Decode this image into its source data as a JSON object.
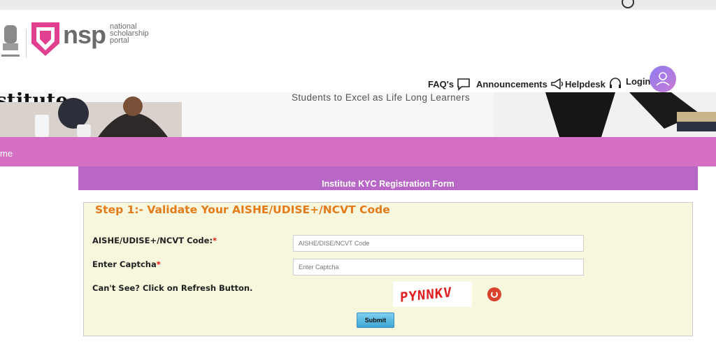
{
  "header": {
    "logo_text": "nsp",
    "logo_sub": [
      "national",
      "scholarship",
      "portal"
    ]
  },
  "nav": {
    "faqs": "FAQ's",
    "announcements": "Announcements",
    "helpdesk": "Helpdesk",
    "login": "Login"
  },
  "banner": {
    "title_fragment": "stitute",
    "tagline": "Students to Excel as Life Long Learners"
  },
  "menu": {
    "home_fragment": "me"
  },
  "form": {
    "title": "Institute KYC Registration Form",
    "step_title": "Step 1:- Validate Your AISHE/UDISE+/NCVT Code",
    "code_label": "AISHE/UDISE+/NCVT Code:",
    "code_placeholder": "AISHE/DISE/NCVT Code",
    "captcha_label": "Enter Captcha",
    "captcha_placeholder": "Enter Captcha",
    "refresh_hint": "Can't See? Click on Refresh Button.",
    "captcha_text": "PYNNKV",
    "submit_label": "Submit",
    "required_mark": "*"
  },
  "colors": {
    "menu_bar": "#d46fc4",
    "form_bar": "#b967c7",
    "step_title": "#e47a1a",
    "panel_bg": "#f6f7dc"
  }
}
